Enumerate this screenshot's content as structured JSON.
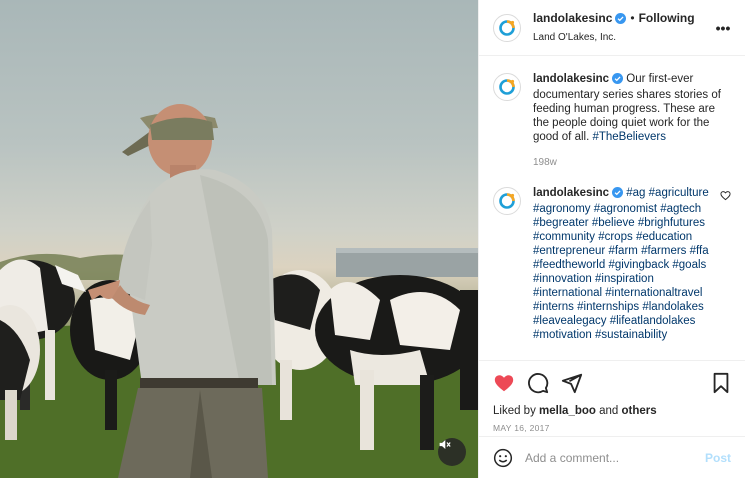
{
  "colors": {
    "verified_blue": "#3897f0",
    "hashtag": "#00376b",
    "like_red": "#ed4956",
    "post_button": "#b2dffc",
    "meta_gray": "#8e8e8e",
    "logo_orange": "#f5a623",
    "logo_blue": "#1f9fd7"
  },
  "icons": {
    "avatar": "land-o-lakes-logo",
    "verified": "verified-badge-icon",
    "more": "more-options-icon",
    "like": "heart-filled-icon",
    "comment": "comment-icon",
    "share": "share-icon",
    "save": "bookmark-icon",
    "emoji": "emoji-icon",
    "mute": "muted-speaker-icon"
  },
  "header": {
    "username": "landolakesinc",
    "separator": "•",
    "following": "Following",
    "subtitle": "Land O'Lakes, Inc."
  },
  "more_glyph": "•••",
  "caption": {
    "username": "landolakesinc",
    "text": "Our first-ever documentary series shares stories of feeding human progress. These are the people doing quiet work for the good of all.",
    "hashtag": "#TheBelievers",
    "age": "198w"
  },
  "comment": {
    "username": "landolakesinc",
    "hashtags": [
      "#ag",
      "#agriculture",
      "#agronomy",
      "#agronomist",
      "#agtech",
      "#begreater",
      "#believe",
      "#brighfutures",
      "#community",
      "#crops",
      "#education",
      "#entrepreneur",
      "#farm",
      "#farmers",
      "#ffa",
      "#feedtheworld",
      "#givingback",
      "#goals",
      "#innovation",
      "#inspiration",
      "#international",
      "#internationaltravel",
      "#interns",
      "#internships",
      "#landolakes",
      "#leavealegacy",
      "#lifeatlandolakes",
      "#motivation",
      "#sustainability"
    ]
  },
  "likes": {
    "prefix": "Liked by",
    "user": "mella_boo",
    "conjunction": "and",
    "others": "others"
  },
  "date": "MAY 16, 2017",
  "add_comment": {
    "placeholder": "Add a comment...",
    "post_label": "Post"
  }
}
